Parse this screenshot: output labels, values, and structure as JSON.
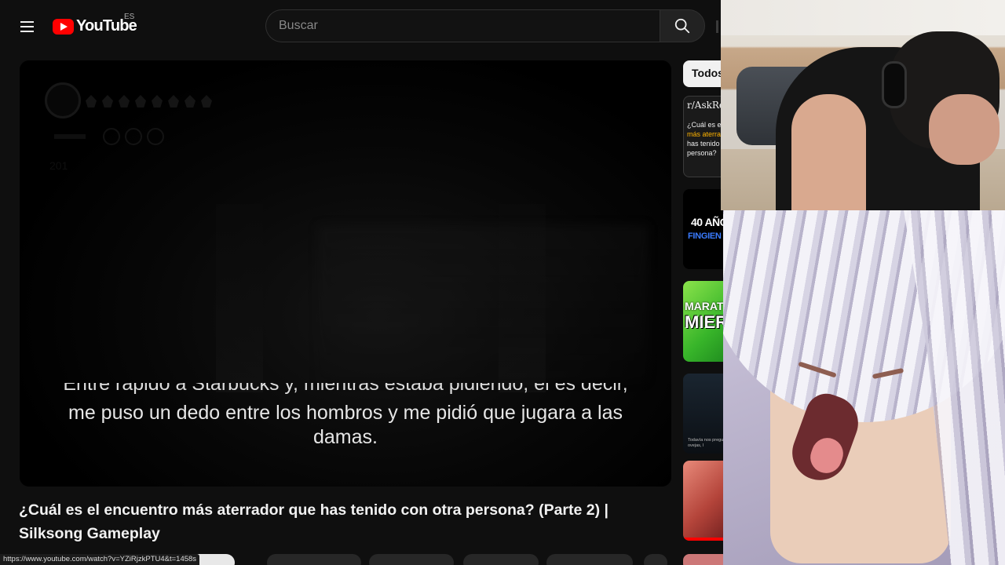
{
  "header": {
    "logo_text": "YouTube",
    "region": "ES",
    "search_placeholder": "Buscar"
  },
  "player": {
    "subtitle_cut": "Entré rápido a Starbucks y, mientras estaba pidiendo, el es decir,",
    "subtitle": "me puso un dedo entre los hombros y me pidió que jugara a las damas.",
    "hud_money": "201"
  },
  "video": {
    "title": "¿Cuál es el encuentro más aterrador que has tenido con otra persona? (Parte 2) | Silksong Gameplay"
  },
  "status_url": "https://www.youtube.com/watch?v=YZiRjzkPTU4&t=1458s",
  "sidebar": {
    "chip": "Todos",
    "thumbs": [
      {
        "line1": "r/AskRe",
        "line2a": "¿Cuál es el",
        "line2b": "más aterra",
        "line2c": "has tenido",
        "line2d": "persona?"
      },
      {
        "line1": "40 AÑO",
        "line2": "FINGIEN"
      },
      {
        "line1": "MARAT",
        "line2": "MIER"
      },
      {
        "line1": "Todavía nos pregu",
        "line2": "ovejas, l"
      }
    ]
  },
  "colors": {
    "brand_red": "#ff0000",
    "background": "#0f0f0f",
    "chip_bg": "#f1f1f1"
  }
}
